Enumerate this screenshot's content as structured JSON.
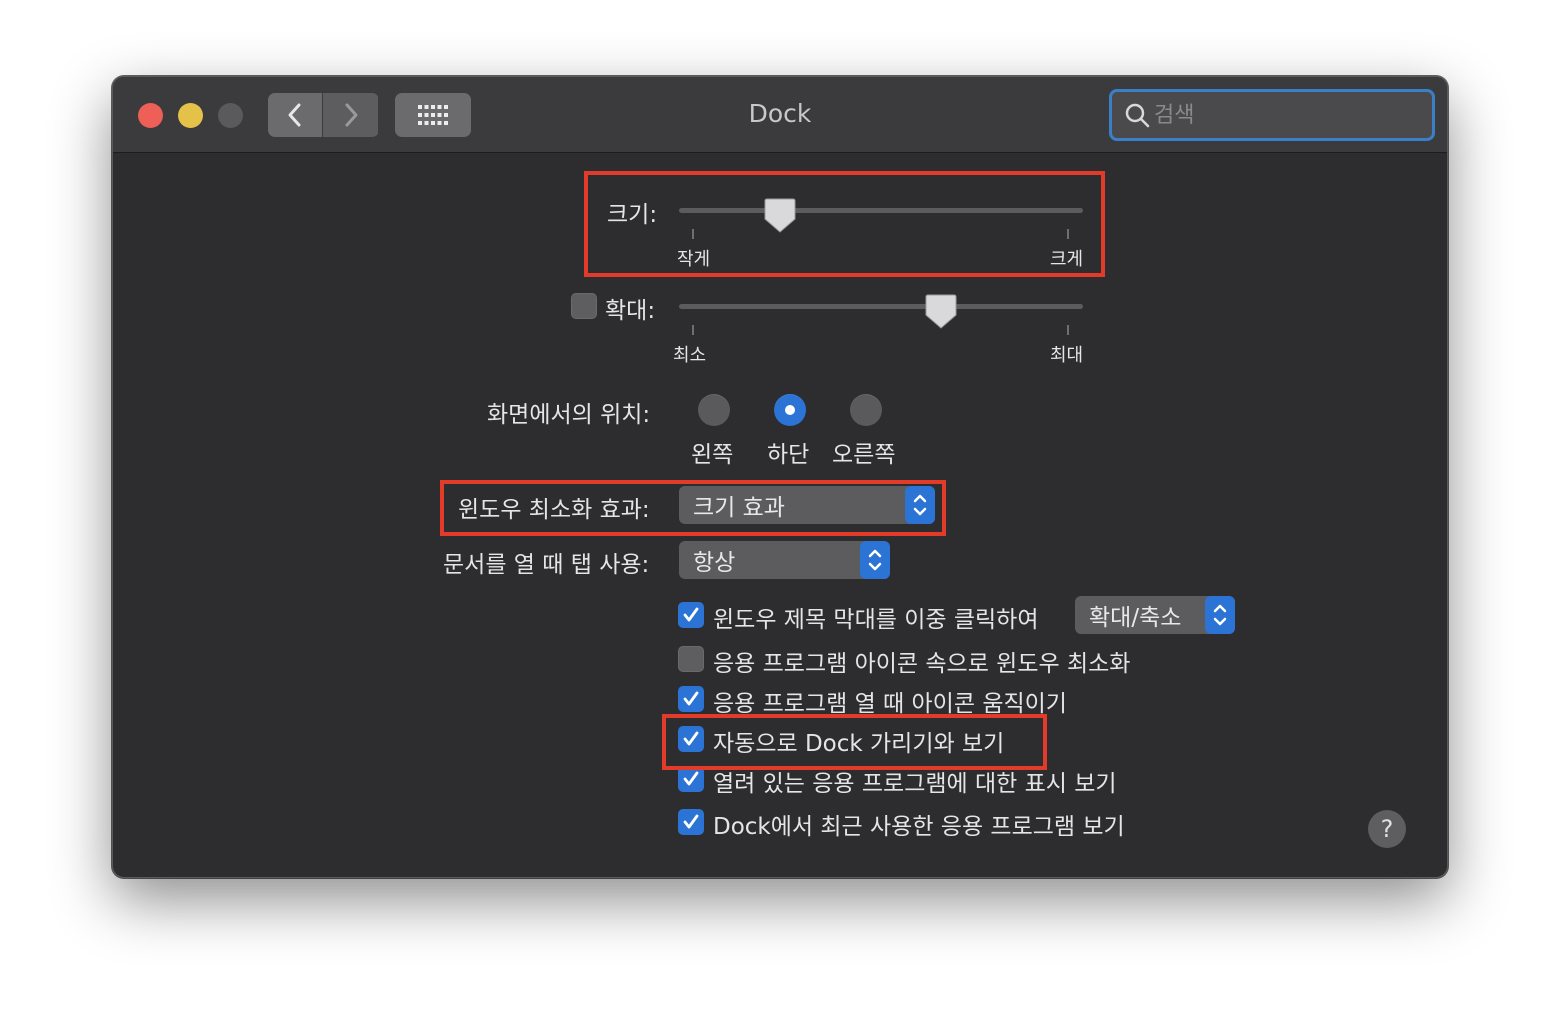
{
  "window": {
    "title": "Dock"
  },
  "search": {
    "placeholder": "검색"
  },
  "size": {
    "label": "크기:",
    "min_label": "작게",
    "max_label": "크게",
    "value_fraction": 0.25
  },
  "magnification": {
    "label": "확대:",
    "enabled": false,
    "min_label": "최소",
    "max_label": "최대",
    "value_fraction": 0.65
  },
  "position": {
    "label": "화면에서의 위치:",
    "options": [
      "왼쪽",
      "하단",
      "오른쪽"
    ],
    "selected": "하단"
  },
  "minimize_effect": {
    "label": "윈도우 최소화 효과:",
    "value": "크기 효과"
  },
  "tabs": {
    "label": "문서를 열 때 탭 사용:",
    "value": "항상"
  },
  "options": [
    {
      "label": "윈도우 제목 막대를 이중 클릭하여",
      "checked": true,
      "popup_value": "확대/축소"
    },
    {
      "label": "응용 프로그램 아이콘 속으로 윈도우 최소화",
      "checked": false
    },
    {
      "label": "응용 프로그램 열 때 아이콘 움직이기",
      "checked": true
    },
    {
      "label": "자동으로 Dock 가리기와 보기",
      "checked": true
    },
    {
      "label": "열려 있는 응용 프로그램에 대한 표시 보기",
      "checked": true
    },
    {
      "label": "Dock에서 최근 사용한 응용 프로그램 보기",
      "checked": true
    }
  ],
  "help": {
    "label": "?"
  },
  "colors": {
    "accent": "#2b73d4",
    "highlight": "#e23b2a",
    "background": "#2d2d2f"
  }
}
